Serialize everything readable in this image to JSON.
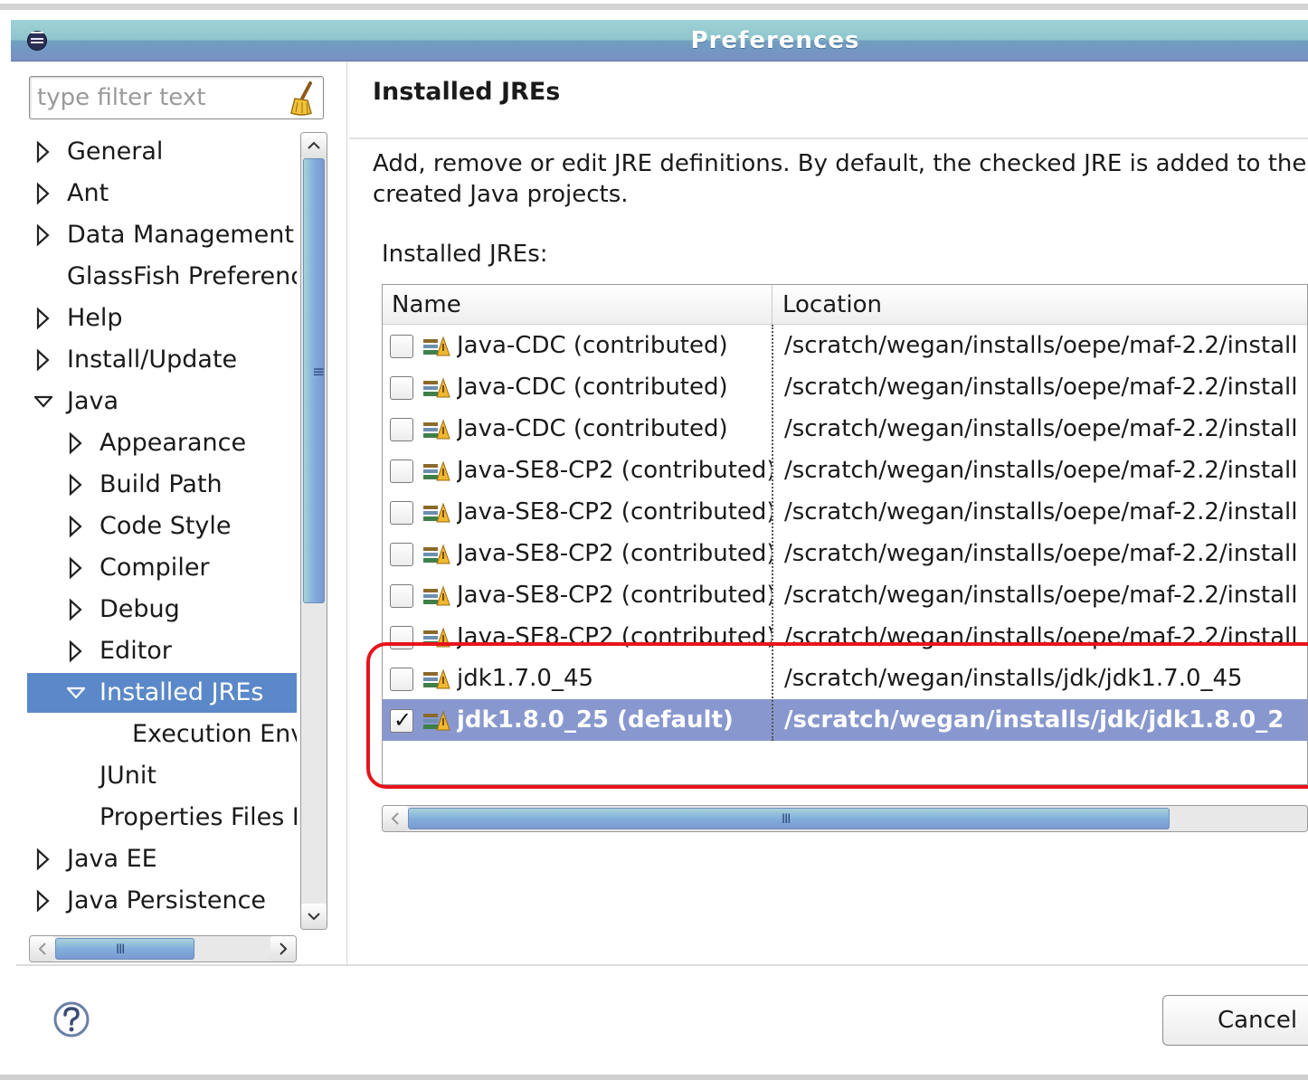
{
  "window": {
    "title": "Preferences"
  },
  "filter": {
    "placeholder": "type filter text"
  },
  "tree": {
    "items": [
      {
        "label": "General",
        "expander": "collapsed",
        "indent": 0
      },
      {
        "label": "Ant",
        "expander": "collapsed",
        "indent": 0
      },
      {
        "label": "Data Management",
        "expander": "collapsed",
        "indent": 0
      },
      {
        "label": "GlassFish Preferenc",
        "expander": "none",
        "indent": 0
      },
      {
        "label": "Help",
        "expander": "collapsed",
        "indent": 0
      },
      {
        "label": "Install/Update",
        "expander": "collapsed",
        "indent": 0
      },
      {
        "label": "Java",
        "expander": "expanded",
        "indent": 0
      },
      {
        "label": "Appearance",
        "expander": "collapsed",
        "indent": 1
      },
      {
        "label": "Build Path",
        "expander": "collapsed",
        "indent": 1
      },
      {
        "label": "Code Style",
        "expander": "collapsed",
        "indent": 1
      },
      {
        "label": "Compiler",
        "expander": "collapsed",
        "indent": 1
      },
      {
        "label": "Debug",
        "expander": "collapsed",
        "indent": 1
      },
      {
        "label": "Editor",
        "expander": "collapsed",
        "indent": 1
      },
      {
        "label": "Installed JREs",
        "expander": "expanded",
        "indent": 1,
        "selected": true
      },
      {
        "label": "Execution Env",
        "expander": "none",
        "indent": 2
      },
      {
        "label": "JUnit",
        "expander": "none",
        "indent": 1
      },
      {
        "label": "Properties Files I",
        "expander": "none",
        "indent": 1
      },
      {
        "label": "Java EE",
        "expander": "collapsed",
        "indent": 0
      },
      {
        "label": "Java Persistence",
        "expander": "collapsed",
        "indent": 0
      }
    ]
  },
  "page": {
    "title": "Installed JREs",
    "description_line1": "Add, remove or edit JRE definitions. By default, the checked JRE is added to the",
    "description_line2": "created Java projects.",
    "section_label": "Installed JREs:"
  },
  "table": {
    "columns": {
      "name": "Name",
      "location": "Location"
    },
    "rows": [
      {
        "name": "Java-CDC (contributed)",
        "location": "/scratch/wegan/installs/oepe/maf-2.2/install",
        "checked": false
      },
      {
        "name": "Java-CDC (contributed)",
        "location": "/scratch/wegan/installs/oepe/maf-2.2/install",
        "checked": false
      },
      {
        "name": "Java-CDC (contributed)",
        "location": "/scratch/wegan/installs/oepe/maf-2.2/install",
        "checked": false
      },
      {
        "name": "Java-SE8-CP2 (contributed)",
        "location": "/scratch/wegan/installs/oepe/maf-2.2/install",
        "checked": false
      },
      {
        "name": "Java-SE8-CP2 (contributed)",
        "location": "/scratch/wegan/installs/oepe/maf-2.2/install",
        "checked": false
      },
      {
        "name": "Java-SE8-CP2 (contributed)",
        "location": "/scratch/wegan/installs/oepe/maf-2.2/install",
        "checked": false
      },
      {
        "name": "Java-SE8-CP2 (contributed)",
        "location": "/scratch/wegan/installs/oepe/maf-2.2/install",
        "checked": false
      },
      {
        "name": "Java-SE8-CP2 (contributed)",
        "location": "/scratch/wegan/installs/oepe/maf-2.2/install",
        "checked": false
      },
      {
        "name": "jdk1.7.0_45",
        "location": "/scratch/wegan/installs/jdk/jdk1.7.0_45",
        "checked": false
      },
      {
        "name": "jdk1.8.0_25 (default)",
        "location": "/scratch/wegan/installs/jdk/jdk1.8.0_2",
        "checked": true,
        "selected": true
      }
    ]
  },
  "scroll_grip": "III",
  "buttons": {
    "cancel": "Cancel",
    "checkmark": "✓"
  },
  "colors": {
    "selection": "#5b88c9",
    "row_selection": "#8898cf",
    "highlight_outline": "#e8141b"
  }
}
